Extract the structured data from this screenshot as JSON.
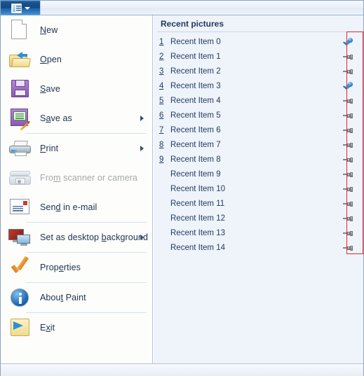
{
  "window": {
    "app_tab_label": "",
    "app_tab_icon": "paint-menu-icon",
    "caret_icon": "chevron-down-icon"
  },
  "menu": {
    "items": [
      {
        "id": "new",
        "label": "New",
        "mnemonic": "N",
        "icon": "new-document-icon",
        "disabled": false,
        "submenu": false,
        "separator_after": false
      },
      {
        "id": "open",
        "label": "Open",
        "mnemonic": "O",
        "icon": "open-folder-icon",
        "disabled": false,
        "submenu": false,
        "separator_after": false
      },
      {
        "id": "save",
        "label": "Save",
        "mnemonic": "S",
        "icon": "floppy-disk-icon",
        "disabled": false,
        "submenu": false,
        "separator_after": false
      },
      {
        "id": "save-as",
        "label": "Save as",
        "mnemonic": "a",
        "icon": "floppy-disk-pencil-icon",
        "disabled": false,
        "submenu": true,
        "separator_after": true
      },
      {
        "id": "print",
        "label": "Print",
        "mnemonic": "P",
        "icon": "printer-icon",
        "disabled": false,
        "submenu": true,
        "separator_after": false
      },
      {
        "id": "scanner",
        "label": "From scanner or camera",
        "mnemonic": "m",
        "icon": "scanner-camera-icon",
        "disabled": true,
        "submenu": false,
        "separator_after": false
      },
      {
        "id": "email",
        "label": "Send in e-mail",
        "mnemonic": "d",
        "icon": "envelope-icon",
        "disabled": false,
        "submenu": false,
        "separator_after": true
      },
      {
        "id": "desktop-bg",
        "label": "Set as desktop background",
        "mnemonic": "b",
        "icon": "monitor-icon",
        "disabled": false,
        "submenu": true,
        "separator_after": true
      },
      {
        "id": "properties",
        "label": "Properties",
        "mnemonic": "e",
        "icon": "orange-check-icon",
        "disabled": false,
        "submenu": false,
        "separator_after": true
      },
      {
        "id": "about",
        "label": "About Paint",
        "mnemonic": "t",
        "icon": "info-circle-icon",
        "disabled": false,
        "submenu": false,
        "separator_after": true
      },
      {
        "id": "exit",
        "label": "Exit",
        "mnemonic": "x",
        "icon": "exit-arrow-icon",
        "disabled": false,
        "submenu": false,
        "separator_after": false
      }
    ]
  },
  "recent": {
    "header": "Recent pictures",
    "highlight_color": "#e8242a",
    "items": [
      {
        "number": "1",
        "label": "Recent Item 0",
        "pinned": true
      },
      {
        "number": "2",
        "label": "Recent Item 1",
        "pinned": false
      },
      {
        "number": "3",
        "label": "Recent Item 2",
        "pinned": false
      },
      {
        "number": "4",
        "label": "Recent Item 3",
        "pinned": true
      },
      {
        "number": "5",
        "label": "Recent Item 4",
        "pinned": false
      },
      {
        "number": "6",
        "label": "Recent Item 5",
        "pinned": false
      },
      {
        "number": "7",
        "label": "Recent Item 6",
        "pinned": false
      },
      {
        "number": "8",
        "label": "Recent Item 7",
        "pinned": false
      },
      {
        "number": "9",
        "label": "Recent Item 8",
        "pinned": false
      },
      {
        "number": "",
        "label": "Recent Item 9",
        "pinned": false
      },
      {
        "number": "",
        "label": "Recent Item 10",
        "pinned": false
      },
      {
        "number": "",
        "label": "Recent Item 11",
        "pinned": false
      },
      {
        "number": "",
        "label": "Recent Item 12",
        "pinned": false
      },
      {
        "number": "",
        "label": "Recent Item 13",
        "pinned": false
      },
      {
        "number": "",
        "label": "Recent Item 14",
        "pinned": false
      }
    ]
  }
}
